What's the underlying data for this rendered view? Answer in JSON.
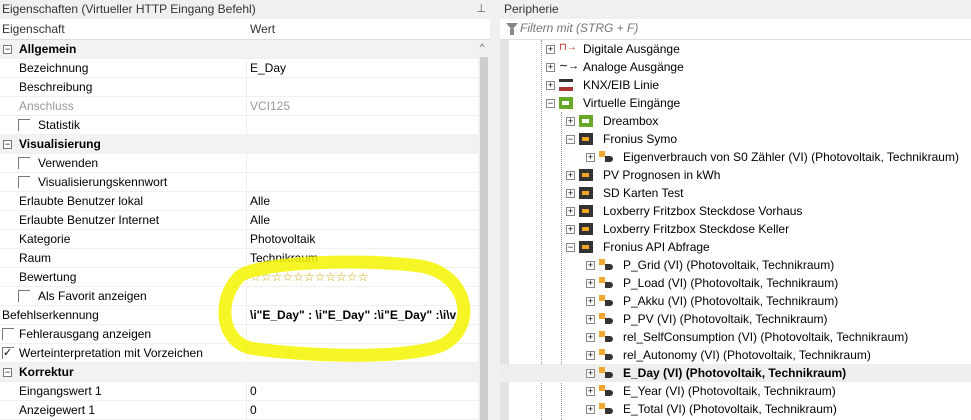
{
  "left_panel": {
    "title": "Eigenschaften (Virtueller HTTP Eingang Befehl)",
    "pin_icon": "pin-icon",
    "col_property": "Eigenschaft",
    "col_value": "Wert",
    "rows": [
      {
        "type": "cat",
        "name": "Allgemein"
      },
      {
        "type": "prop",
        "name": "Bezeichnung",
        "value": "E_Day"
      },
      {
        "type": "prop",
        "name": "Beschreibung",
        "value": ""
      },
      {
        "type": "dis",
        "name": "Anschluss",
        "value": "VCI125"
      },
      {
        "type": "check",
        "name": "Statistik",
        "checked": false
      },
      {
        "type": "cat",
        "name": "Visualisierung"
      },
      {
        "type": "check",
        "name": "Verwenden",
        "checked": false
      },
      {
        "type": "check",
        "name": "Visualisierungskennwort",
        "checked": false
      },
      {
        "type": "prop",
        "name": "Erlaubte Benutzer lokal",
        "value": "Alle"
      },
      {
        "type": "prop",
        "name": "Erlaubte Benutzer Internet",
        "value": "Alle"
      },
      {
        "type": "prop",
        "name": "Kategorie",
        "value": "Photovoltaik"
      },
      {
        "type": "prop",
        "name": "Raum",
        "value": "Technikraum"
      },
      {
        "type": "stars",
        "name": "Bewertung",
        "value": "☆☆☆☆☆☆☆☆☆☆☆"
      },
      {
        "type": "check",
        "name": "Als Favorit anzeigen",
        "checked": false
      },
      {
        "type": "flat",
        "name": "Befehlserkennung",
        "value": "\\i\"E_Day\" : \\i\"E_Day\" :\\i\"E_Day\" :\\i\\v"
      },
      {
        "type": "flatcheck",
        "name": "Fehlerausgang anzeigen",
        "checked": false
      },
      {
        "type": "flatcheck",
        "name": "Werteinterpretation mit Vorzeichen",
        "checked": true
      },
      {
        "type": "cat",
        "name": "Korrektur"
      },
      {
        "type": "prop",
        "name": "Eingangswert 1",
        "value": "0"
      },
      {
        "type": "prop",
        "name": "Anzeigewert 1",
        "value": "0"
      }
    ]
  },
  "right_panel": {
    "title": "Peripherie",
    "filter_placeholder": "Filtern mit (STRG + F)",
    "tree": [
      {
        "level": 1,
        "label": "Digitale Ausgänge",
        "icon": "digital-output-icon",
        "expanded": false
      },
      {
        "level": 1,
        "label": "Analoge Ausgänge",
        "icon": "analog-output-icon",
        "expanded": false
      },
      {
        "level": 1,
        "label": "KNX/EIB Linie",
        "icon": "knx-line-icon",
        "expanded": false
      },
      {
        "level": 1,
        "label": "Virtuelle Eingänge",
        "icon": "virtual-input-green-icon",
        "expanded": true
      },
      {
        "level": 2,
        "label": "Dreambox",
        "icon": "virtual-input-green-icon",
        "expanded": false
      },
      {
        "level": 2,
        "label": "Fronius Symo",
        "icon": "virtual-input-dark-icon",
        "expanded": true
      },
      {
        "level": 3,
        "label": "Eigenverbrauch von S0 Zähler (VI) (Photovoltaik, Technikraum)",
        "icon": "virtual-input-command-icon",
        "expanded": false
      },
      {
        "level": 2,
        "label": "PV Prognosen in kWh",
        "icon": "virtual-input-dark-icon",
        "expanded": false
      },
      {
        "level": 2,
        "label": "SD Karten Test",
        "icon": "virtual-input-dark-icon",
        "expanded": false
      },
      {
        "level": 2,
        "label": "Loxberry Fritzbox Steckdose Vorhaus",
        "icon": "virtual-input-dark-icon",
        "expanded": false
      },
      {
        "level": 2,
        "label": "Loxberry Fritzbox Steckdose Keller",
        "icon": "virtual-input-dark-icon",
        "expanded": false
      },
      {
        "level": 2,
        "label": "Fronius API Abfrage",
        "icon": "virtual-input-dark-icon",
        "expanded": true
      },
      {
        "level": 3,
        "label": "P_Grid (VI) (Photovoltaik, Technikraum)",
        "icon": "virtual-input-command-icon"
      },
      {
        "level": 3,
        "label": "P_Load (VI) (Photovoltaik, Technikraum)",
        "icon": "virtual-input-command-icon"
      },
      {
        "level": 3,
        "label": "P_Akku (VI) (Photovoltaik, Technikraum)",
        "icon": "virtual-input-command-icon"
      },
      {
        "level": 3,
        "label": "P_PV (VI) (Photovoltaik, Technikraum)",
        "icon": "virtual-input-command-icon"
      },
      {
        "level": 3,
        "label": "rel_SelfConsumption (VI) (Photovoltaik, Technikraum)",
        "icon": "virtual-input-command-icon"
      },
      {
        "level": 3,
        "label": "rel_Autonomy (VI) (Photovoltaik, Technikraum)",
        "icon": "virtual-input-command-icon"
      },
      {
        "level": 3,
        "label": "E_Day (VI) (Photovoltaik, Technikraum)",
        "icon": "virtual-input-command-icon",
        "selected": true
      },
      {
        "level": 3,
        "label": "E_Year (VI) (Photovoltaik, Technikraum)",
        "icon": "virtual-input-command-icon"
      },
      {
        "level": 3,
        "label": "E_Total (VI) (Photovoltaik, Technikraum)",
        "icon": "virtual-input-command-icon"
      }
    ]
  },
  "colors": {
    "highlight": "#f5f500",
    "stars": "#c9a400"
  }
}
